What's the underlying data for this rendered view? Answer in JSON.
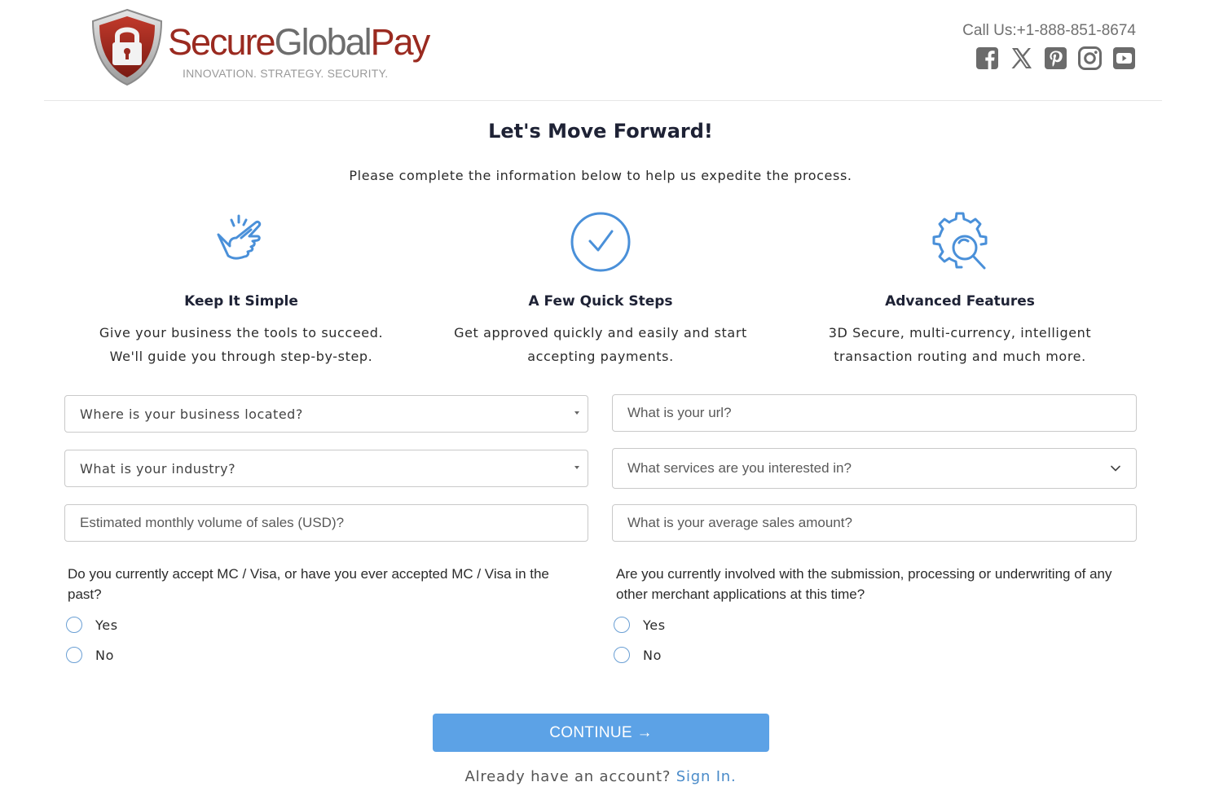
{
  "header": {
    "logo": {
      "name_part1": "Secure",
      "name_part2": "Global",
      "name_part3": "Pay",
      "tagline": "INNOVATION. STRATEGY. SECURITY."
    },
    "call_us": "Call Us:+1-888-851-8674",
    "social": [
      {
        "icon": "facebook-icon"
      },
      {
        "icon": "x-twitter-icon"
      },
      {
        "icon": "pinterest-icon"
      },
      {
        "icon": "instagram-icon"
      },
      {
        "icon": "youtube-icon"
      }
    ]
  },
  "intro": {
    "title": "Let's Move Forward!",
    "subtitle": "Please complete the information below to help us expedite the process."
  },
  "features": [
    {
      "icon": "pointing-hand-icon",
      "title": "Keep It Simple",
      "line1": "Give your business the tools to succeed.",
      "line2": "We'll guide you through step-by-step."
    },
    {
      "icon": "check-circle-icon",
      "title": "A Few Quick Steps",
      "line1": "Get approved quickly and easily and start",
      "line2": "accepting payments."
    },
    {
      "icon": "gear-search-icon",
      "title": "Advanced Features",
      "line1": "3D Secure, multi-currency, intelligent",
      "line2": "transaction routing and much more."
    }
  ],
  "form": {
    "location_select": "Where is your business located?",
    "url_placeholder": "What is your url?",
    "industry_select": "What is your industry?",
    "services_select": "What services are you interested in?",
    "volume_placeholder": "Estimated monthly volume of sales (USD)?",
    "avg_sale_placeholder": "What is your average sales amount?",
    "q1": {
      "text": "Do you currently accept MC / Visa, or have you ever accepted MC / Visa in the past?",
      "options": [
        "Yes",
        "No"
      ]
    },
    "q2": {
      "text": "Are you currently involved with the submission, processing or underwriting of any other merchant applications at this time?",
      "options": [
        "Yes",
        "No"
      ]
    },
    "continue_label": "CONTINUE →",
    "already_text": "Already have an account?",
    "sign_in_label": "Sign In."
  },
  "colors": {
    "brand_red": "#9a2a20",
    "accent_blue": "#5ca2e6",
    "icon_blue": "#4a90d9",
    "link_blue": "#4a8bc9"
  }
}
